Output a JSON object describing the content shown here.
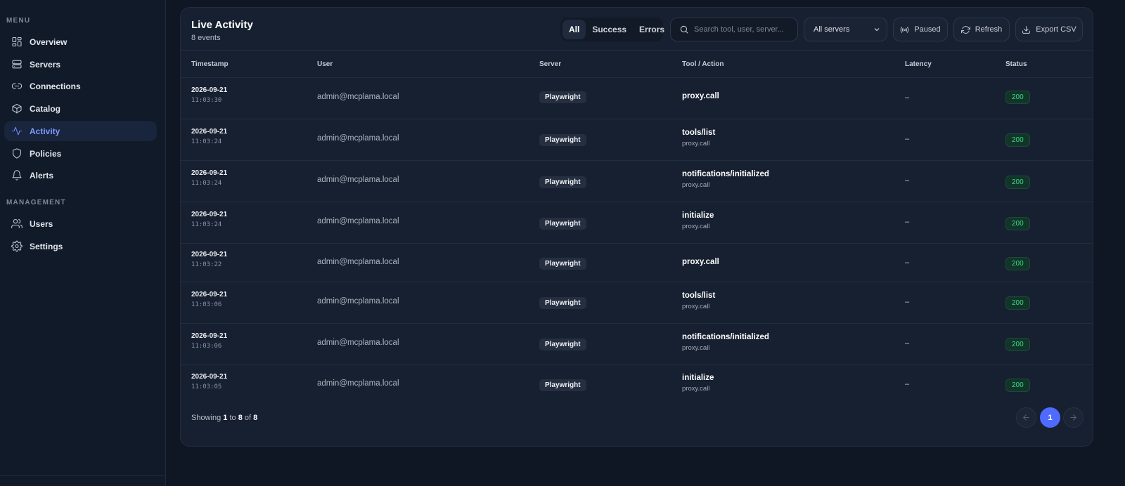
{
  "sidebar": {
    "menu_label": "MENU",
    "management_label": "MANAGEMENT",
    "menu_items": [
      {
        "label": "Overview",
        "icon": "grid-icon"
      },
      {
        "label": "Servers",
        "icon": "server-icon"
      },
      {
        "label": "Connections",
        "icon": "link-icon"
      },
      {
        "label": "Catalog",
        "icon": "box-icon"
      },
      {
        "label": "Activity",
        "icon": "activity-icon",
        "active": true
      },
      {
        "label": "Policies",
        "icon": "shield-icon"
      },
      {
        "label": "Alerts",
        "icon": "bell-icon"
      }
    ],
    "management_items": [
      {
        "label": "Users",
        "icon": "users-icon"
      },
      {
        "label": "Settings",
        "icon": "gear-icon"
      }
    ]
  },
  "activity": {
    "title": "Live Activity",
    "subtitle": "8 events",
    "filters": [
      "All",
      "Success",
      "Errors"
    ],
    "active_filter": "All",
    "search_placeholder": "Search tool, user, server...",
    "server_select": "All servers",
    "paused_label": "Paused",
    "refresh_label": "Refresh",
    "export_label": "Export CSV",
    "columns": {
      "timestamp": "Timestamp",
      "user": "User",
      "server": "Server",
      "tool": "Tool / Action",
      "latency": "Latency",
      "status": "Status"
    },
    "rows": [
      {
        "date": "2026-09-21",
        "time": "11:03:30",
        "user": "admin@mcplama.local",
        "server": "Playwright",
        "tool": "proxy.call",
        "sub": "",
        "latency": "–",
        "status": "200"
      },
      {
        "date": "2026-09-21",
        "time": "11:03:24",
        "user": "admin@mcplama.local",
        "server": "Playwright",
        "tool": "tools/list",
        "sub": "proxy.call",
        "latency": "–",
        "status": "200"
      },
      {
        "date": "2026-09-21",
        "time": "11:03:24",
        "user": "admin@mcplama.local",
        "server": "Playwright",
        "tool": "notifications/initialized",
        "sub": "proxy.call",
        "latency": "–",
        "status": "200"
      },
      {
        "date": "2026-09-21",
        "time": "11:03:24",
        "user": "admin@mcplama.local",
        "server": "Playwright",
        "tool": "initialize",
        "sub": "proxy.call",
        "latency": "–",
        "status": "200"
      },
      {
        "date": "2026-09-21",
        "time": "11:03:22",
        "user": "admin@mcplama.local",
        "server": "Playwright",
        "tool": "proxy.call",
        "sub": "",
        "latency": "–",
        "status": "200"
      },
      {
        "date": "2026-09-21",
        "time": "11:03:06",
        "user": "admin@mcplama.local",
        "server": "Playwright",
        "tool": "tools/list",
        "sub": "proxy.call",
        "latency": "–",
        "status": "200"
      },
      {
        "date": "2026-09-21",
        "time": "11:03:06",
        "user": "admin@mcplama.local",
        "server": "Playwright",
        "tool": "notifications/initialized",
        "sub": "proxy.call",
        "latency": "–",
        "status": "200"
      },
      {
        "date": "2026-09-21",
        "time": "11:03:05",
        "user": "admin@mcplama.local",
        "server": "Playwright",
        "tool": "initialize",
        "sub": "proxy.call",
        "latency": "–",
        "status": "200"
      }
    ],
    "footer": {
      "prefix": "Showing",
      "from": "1",
      "to_word": "to",
      "to": "8",
      "of_word": "of",
      "total": "8"
    },
    "current_page": "1"
  }
}
